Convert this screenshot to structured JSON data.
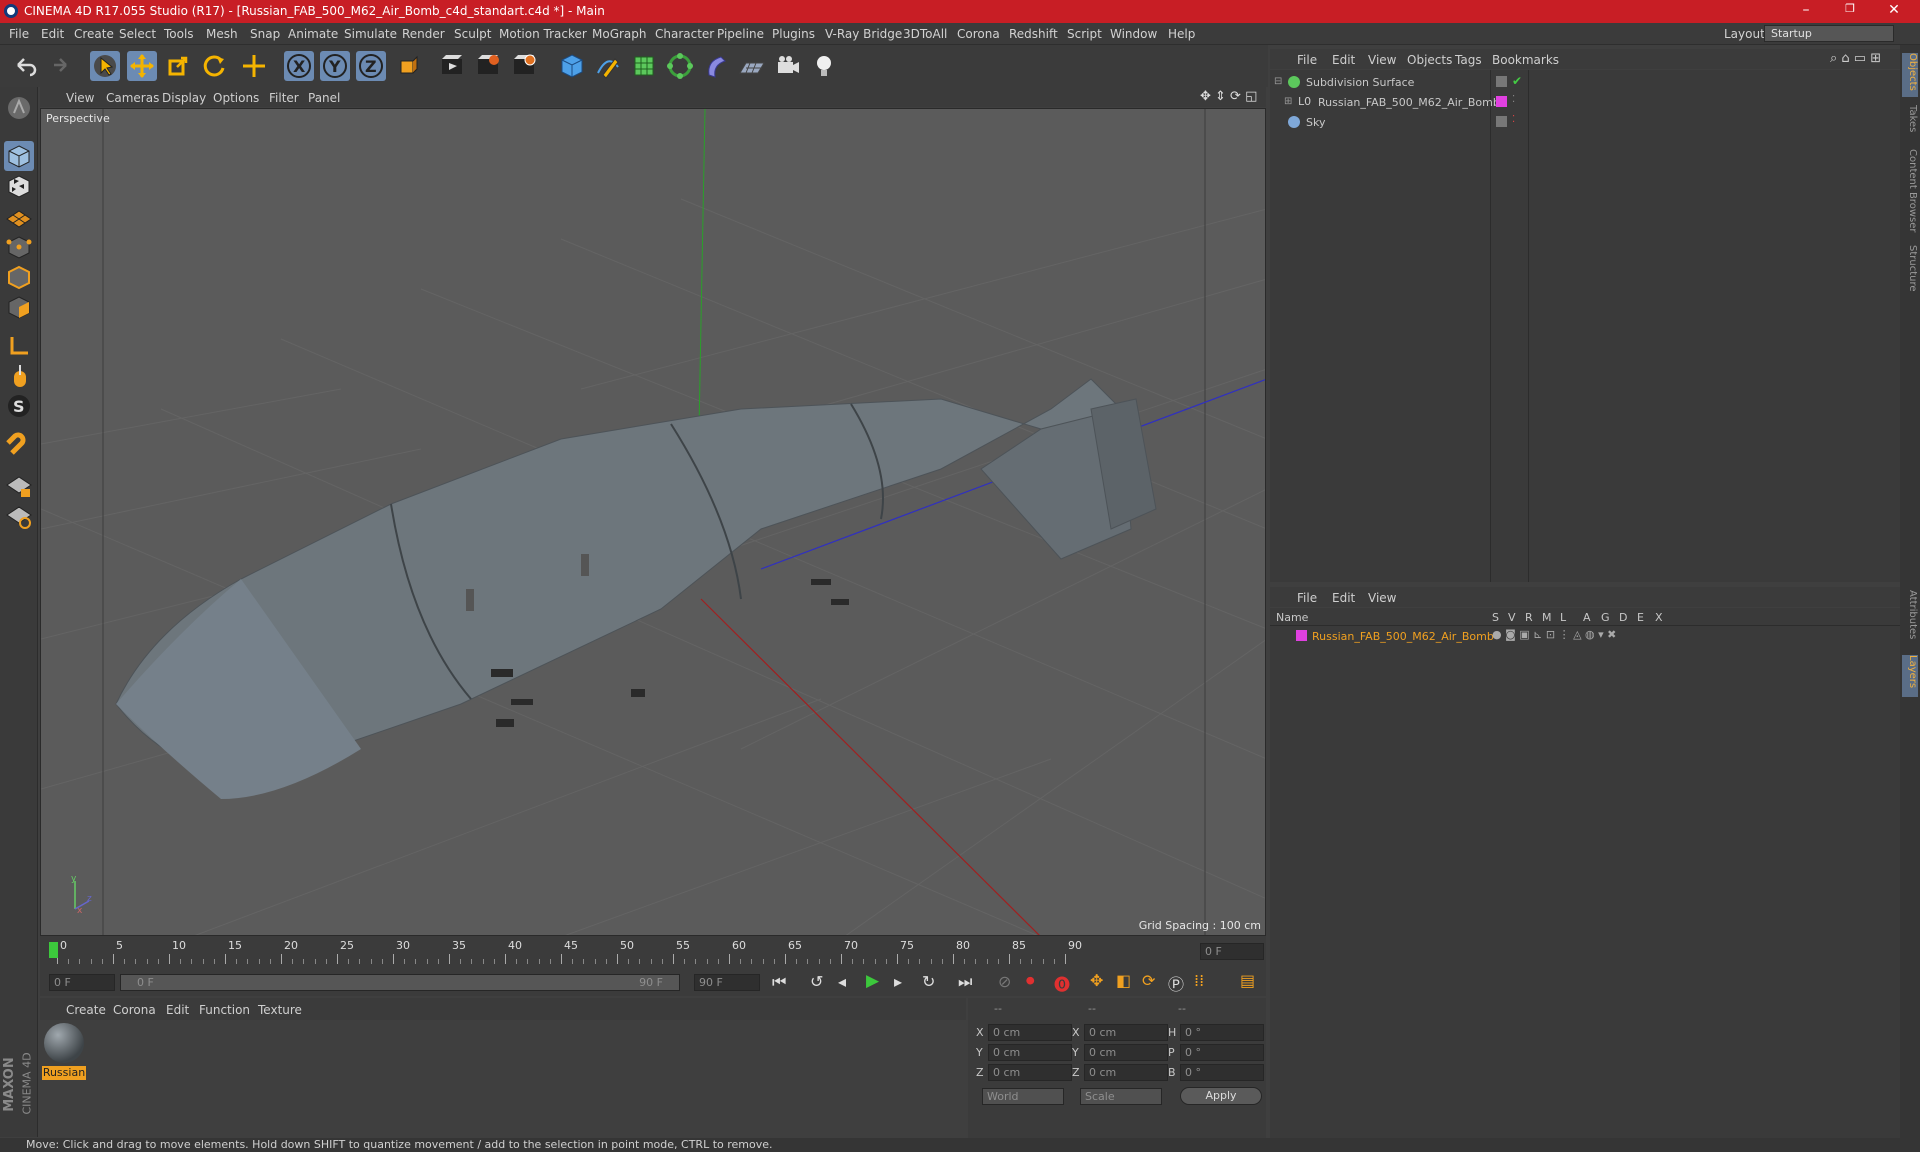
{
  "titlebar": {
    "title": "CINEMA 4D R17.055 Studio (R17) - [Russian_FAB_500_M62_Air_Bomb_c4d_standart.c4d *] - Main",
    "minimize": "–",
    "maximize": "❐",
    "close": "✕"
  },
  "menubar": {
    "items": [
      "File",
      "Edit",
      "Create",
      "Select",
      "Tools",
      "Mesh",
      "Snap",
      "Animate",
      "Simulate",
      "Render",
      "Sculpt",
      "Motion Tracker",
      "MoGraph",
      "Character",
      "Pipeline",
      "Plugins",
      "V-Ray Bridge",
      "3DToAll",
      "Corona",
      "Redshift",
      "Script",
      "Window",
      "Help"
    ],
    "layout_label": "Layout:",
    "layout_value": "Startup"
  },
  "viewport": {
    "menu": [
      "View",
      "Cameras",
      "Display",
      "Options",
      "Filter",
      "Panel"
    ],
    "label": "Perspective",
    "grid_spacing": "Grid Spacing : 100 cm"
  },
  "timeline": {
    "ticks": [
      "0",
      "5",
      "10",
      "15",
      "20",
      "25",
      "30",
      "35",
      "40",
      "45",
      "50",
      "55",
      "60",
      "65",
      "70",
      "75",
      "80",
      "85",
      "90"
    ],
    "current_frame": "0 F",
    "start_field": "0 F",
    "range_start": "0 F",
    "range_end": "90 F",
    "end_field": "90 F"
  },
  "material_panel": {
    "menu": [
      "Create",
      "Corona",
      "Edit",
      "Function",
      "Texture"
    ],
    "material_name": "Russian"
  },
  "coord_panel": {
    "header": [
      "--",
      "--",
      "--"
    ],
    "rows": [
      {
        "a": "X",
        "av": "0 cm",
        "b": "X",
        "bv": "0 cm",
        "c": "H",
        "cv": "0 °"
      },
      {
        "a": "Y",
        "av": "0 cm",
        "b": "Y",
        "bv": "0 cm",
        "c": "P",
        "cv": "0 °"
      },
      {
        "a": "Z",
        "av": "0 cm",
        "b": "Z",
        "bv": "0 cm",
        "c": "B",
        "cv": "0 °"
      }
    ],
    "world": "World",
    "scale": "Scale",
    "apply": "Apply"
  },
  "object_manager": {
    "menu": [
      "File",
      "Edit",
      "View",
      "Objects",
      "Tags",
      "Bookmarks"
    ],
    "objects": [
      {
        "name": "Subdivision Surface",
        "color": "#c8c8c8"
      },
      {
        "name": "Russian_FAB_500_M62_Air_Bomb",
        "color": "#c8c8c8"
      },
      {
        "name": "Sky",
        "color": "#c8c8c8"
      }
    ]
  },
  "layer_manager": {
    "menu": [
      "File",
      "Edit",
      "View"
    ],
    "columns": [
      "Name",
      "S",
      "V",
      "R",
      "M",
      "L",
      "A",
      "G",
      "D",
      "E",
      "X"
    ],
    "layers": [
      {
        "name": "Russian_FAB_500_M62_Air_Bomb",
        "color": "#e040e0",
        "text_color": "#f0a020"
      }
    ]
  },
  "right_tabs": [
    "Objects",
    "Takes",
    "Content Browser",
    "Structure",
    "Attributes",
    "Layers"
  ],
  "statusbar": {
    "text": "Move: Click and drag to move elements. Hold down SHIFT to quantize movement / add to the selection in point mode, CTRL to remove."
  },
  "brand": {
    "maxon": "MAXON",
    "cinema": "CINEMA 4D"
  },
  "colors": {
    "title_red": "#c81e25",
    "accent_blue": "#6c8bb3",
    "layer_orange": "#f0a020"
  }
}
